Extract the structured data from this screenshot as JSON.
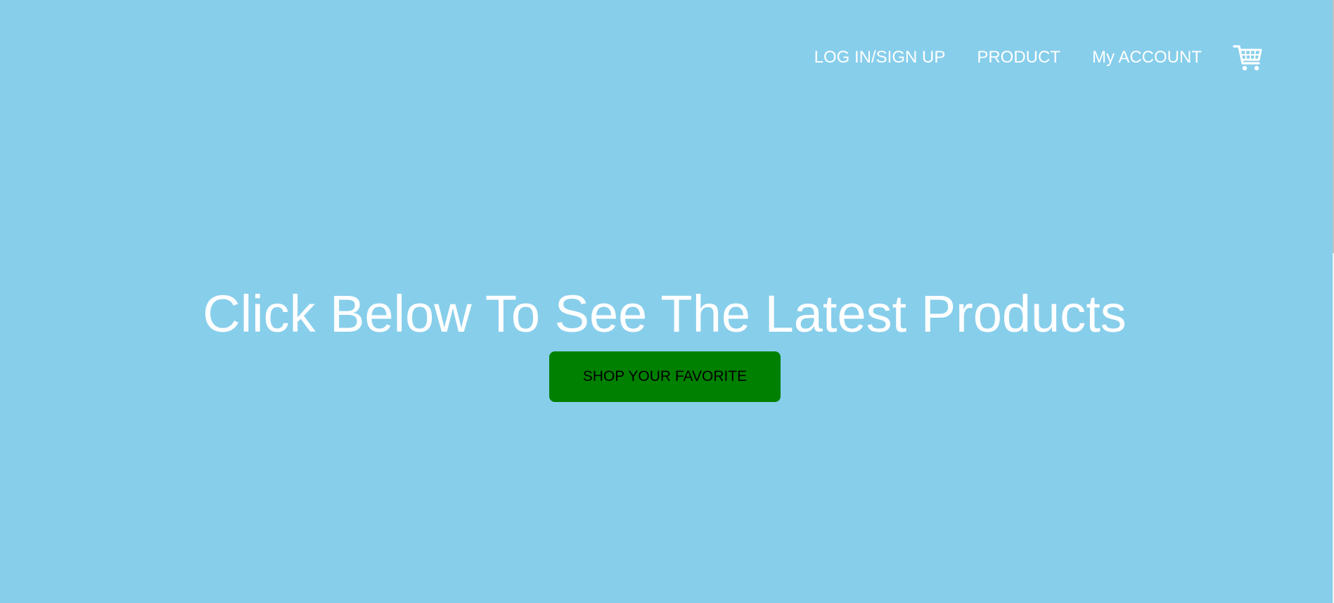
{
  "nav": {
    "login_label": "LOG IN/SIGN UP",
    "product_label": "PRODUCT",
    "account_label": "My ACCOUNT",
    "cart_icon": "cart-icon"
  },
  "hero": {
    "title": "Click Below To See The Latest Products",
    "button_label": "SHOP YOUR FAVORITE"
  },
  "colors": {
    "background": "#87ceeb",
    "button": "#008000",
    "text": "#ffffff"
  }
}
